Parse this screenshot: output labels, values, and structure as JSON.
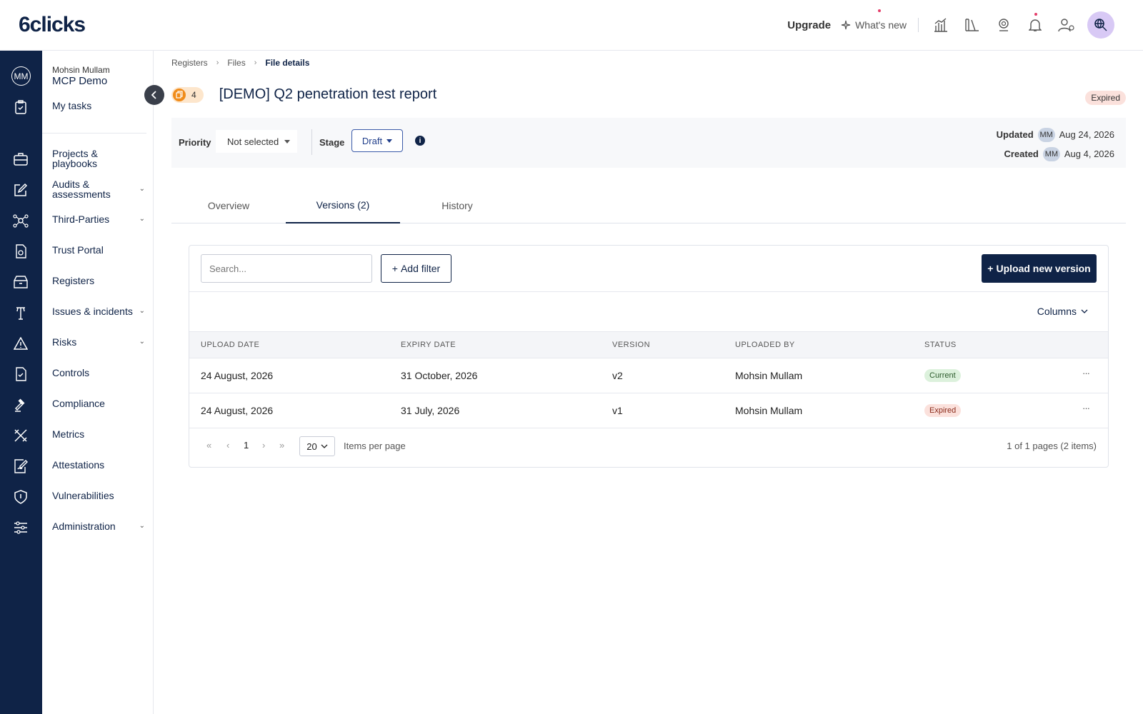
{
  "app": {
    "logo": "6clicks"
  },
  "topbar": {
    "upgrade": "Upgrade",
    "whats_new": "What's new",
    "avatar_initials": "MM"
  },
  "rail": {
    "avatar_initials": "MM"
  },
  "nav": {
    "user_name": "Mohsin Mullam",
    "org_name": "MCP Demo",
    "my_tasks": "My tasks",
    "items": [
      {
        "label": "Projects & playbooks",
        "expandable": false
      },
      {
        "label": "Audits & assessments",
        "expandable": true
      },
      {
        "label": "Third-Parties",
        "expandable": true
      },
      {
        "label": "Trust Portal",
        "expandable": false
      },
      {
        "label": "Registers",
        "expandable": false
      },
      {
        "label": "Issues & incidents",
        "expandable": true
      },
      {
        "label": "Risks",
        "expandable": true
      },
      {
        "label": "Controls",
        "expandable": false
      },
      {
        "label": "Compliance",
        "expandable": false
      },
      {
        "label": "Metrics",
        "expandable": false
      },
      {
        "label": "Attestations",
        "expandable": false
      },
      {
        "label": "Vulnerabilities",
        "expandable": false
      },
      {
        "label": "Administration",
        "expandable": true
      }
    ]
  },
  "breadcrumb": [
    "Registers",
    "Files",
    "File details"
  ],
  "page": {
    "count": "4",
    "title": "[DEMO] Q2 penetration test report",
    "status_badge": "Expired"
  },
  "meta": {
    "priority_label": "Priority",
    "priority_value": "Not selected",
    "stage_label": "Stage",
    "stage_value": "Draft",
    "updated_label": "Updated",
    "updated_by": "MM",
    "updated_date": "Aug 24, 2026",
    "created_label": "Created",
    "created_by": "MM",
    "created_date": "Aug 4, 2026"
  },
  "tabs": [
    "Overview",
    "Versions (2)",
    "History"
  ],
  "active_tab": "Versions (2)",
  "versions": {
    "search_placeholder": "Search...",
    "add_filter": "Add filter",
    "upload": "Upload new version",
    "columns": "Columns",
    "headers": [
      "UPLOAD DATE",
      "EXPIRY DATE",
      "VERSION",
      "UPLOADED BY",
      "STATUS"
    ],
    "rows": [
      {
        "upload_date": "24 August, 2026",
        "expiry_date": "31 October, 2026",
        "version": "v2",
        "uploaded_by": "Mohsin Mullam",
        "status": "Current"
      },
      {
        "upload_date": "24 August, 2026",
        "expiry_date": "31 July, 2026",
        "version": "v1",
        "uploaded_by": "Mohsin Mullam",
        "status": "Expired"
      }
    ],
    "row_menu": "···"
  },
  "pagination": {
    "first": "«",
    "prev": "‹",
    "page": "1",
    "next": "›",
    "last": "»",
    "per_page": "20",
    "per_page_label": "Items per page",
    "summary": "1 of 1 pages (2 items)"
  },
  "colors": {
    "navy": "#0f2347",
    "accent_orange": "#f08c1a",
    "current_green": "#dcf1dc",
    "expired_red": "#fbe1dc"
  }
}
